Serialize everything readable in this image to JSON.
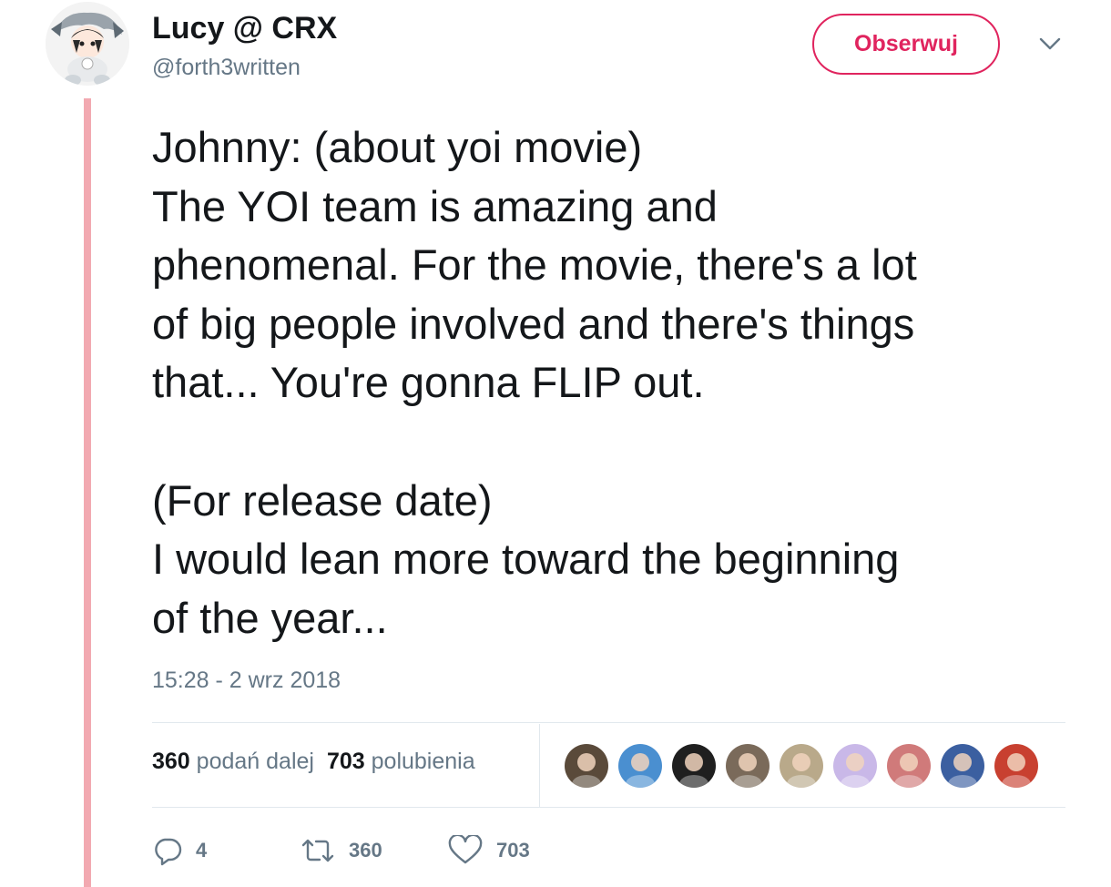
{
  "author": {
    "name": "Lucy @ CRX",
    "handle": "@forth3written"
  },
  "follow_button": {
    "label": "Obserwuj"
  },
  "tweet": {
    "lines": [
      "Johnny: (about yoi movie)",
      "The YOI team is amazing and",
      "phenomenal. For the movie, there's a lot",
      "of big people involved and there's things",
      "that... You're gonna FLIP out.",
      "",
      "(For release date)",
      "I would lean more toward the beginning",
      "of the year..."
    ],
    "timestamp": "15:28 - 2 wrz 2018"
  },
  "stats": {
    "retweets_count": "360",
    "retweets_label": "podań dalej",
    "likes_count": "703",
    "likes_label": "polubienia"
  },
  "likers": [
    {
      "icon": "liker-avatar",
      "color": "#5a4a3a"
    },
    {
      "icon": "liker-avatar",
      "color": "#4a8fd0"
    },
    {
      "icon": "liker-avatar",
      "color": "#1f1f1f"
    },
    {
      "icon": "liker-avatar",
      "color": "#7a6a5a"
    },
    {
      "icon": "liker-avatar",
      "color": "#b9a98a"
    },
    {
      "icon": "liker-avatar",
      "color": "#c9b8e8"
    },
    {
      "icon": "liker-avatar",
      "color": "#d07a7a"
    },
    {
      "icon": "liker-avatar",
      "color": "#3b5fa0"
    },
    {
      "icon": "liker-avatar",
      "color": "#c84030"
    }
  ],
  "actions": {
    "reply_count": "4",
    "retweet_count": "360",
    "like_count": "703"
  },
  "colors": {
    "accent": "#e0245e",
    "thread_line": "#f2a9b1",
    "muted_text": "#657786",
    "main_text": "#14171a",
    "divider": "#e1e8ed"
  }
}
